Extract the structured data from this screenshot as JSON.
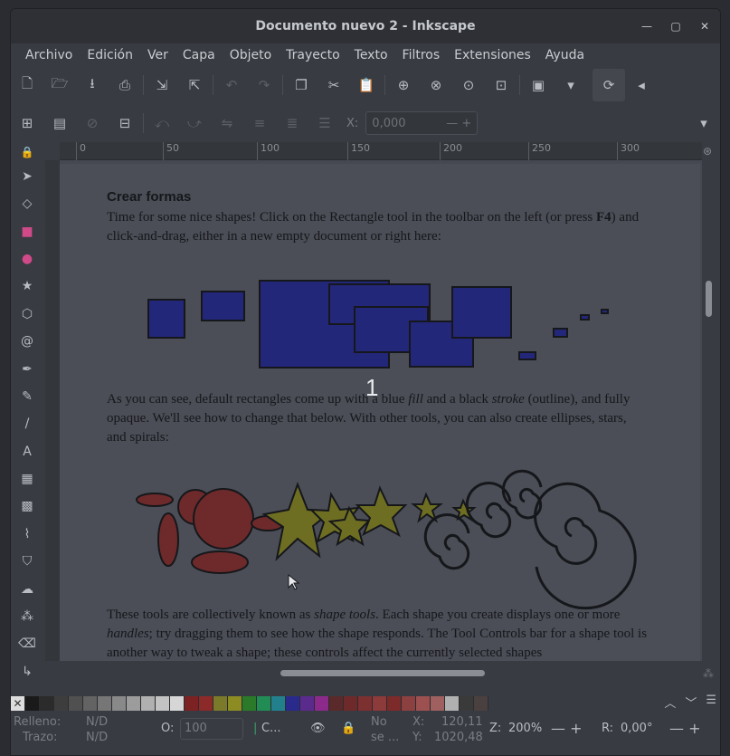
{
  "window": {
    "title": "Documento nuevo 2 - Inkscape"
  },
  "menu": [
    "Archivo",
    "Edición",
    "Ver",
    "Capa",
    "Objeto",
    "Trayecto",
    "Texto",
    "Filtros",
    "Extensiones",
    "Ayuda"
  ],
  "toolbar2": {
    "x_label": "X:",
    "x_value": "0,000"
  },
  "ruler": {
    "labels": [
      "0",
      "50",
      "100",
      "150",
      "200",
      "250",
      "300"
    ]
  },
  "doc": {
    "heading": "Crear formas",
    "p1a": "Time for some nice shapes! Click on the Rectangle tool in the toolbar on the left (or press ",
    "p1key": "F4",
    "p1b": ") and click-and-drag, either in a new empty document or right here:",
    "figure1_label": "1",
    "p2a": "As you can see, default rectangles come up with a blue ",
    "p2fill": "fill",
    "p2b": " and a black ",
    "p2stroke": "stroke",
    "p2c": " (outline), and fully opaque. We'll see how to change that below. With other tools, you can also create ellipses, stars, and spirals:",
    "p3a": "These tools are collectively known as ",
    "p3em": "shape tools",
    "p3b": ". Each shape you create displays one or more ",
    "p3em2": "handles",
    "p3c": "; try dragging them to see how the shape responds. The Tool Controls bar for a shape tool is another way to tweak a shape; these controls affect the currently selected shapes"
  },
  "status": {
    "fill_label": "Relleno:",
    "fill_value": "N/D",
    "stroke_label": "Trazo:",
    "stroke_value": "N/D",
    "opacity_label": "O:",
    "opacity_value": "100",
    "layer": "C...",
    "no_sel_1": "No",
    "no_sel_2": "se ...",
    "x_label": "X:",
    "x_value": "120,11",
    "y_label": "Y:",
    "y_value": "1020,48",
    "zoom_label": "Z:",
    "zoom_value": "200%",
    "rot_label": "R:",
    "rot_value": "0,00°"
  },
  "palette_colors": [
    "#1a1a1a",
    "#2b2b2b",
    "#3d3d3d",
    "#505050",
    "#636363",
    "#767676",
    "#898989",
    "#9c9c9c",
    "#b0b0b0",
    "#c3c3c3",
    "#d6d6d6",
    "#7d2222",
    "#8c2a2a",
    "#7a7a2a",
    "#8c8c22",
    "#2a7a2a",
    "#228c55",
    "#22808c",
    "#2a2a8c",
    "#5a2a8c",
    "#8c2a8c",
    "#5a2a2a",
    "#6e2a2a",
    "#7d3030",
    "#8c3a3a",
    "#7d2a2a",
    "#8c4040",
    "#9c5050",
    "#a06060",
    "#b0b0b0",
    "#3a3a3a",
    "#4a4040"
  ]
}
